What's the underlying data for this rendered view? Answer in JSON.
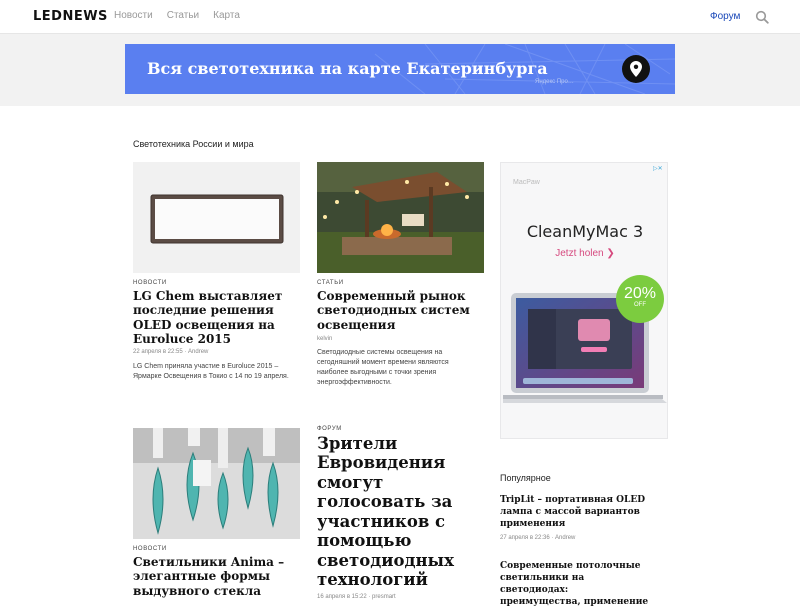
{
  "header": {
    "logo": "LEDNEWS",
    "nav": [
      "Новости",
      "Статьи",
      "Карта"
    ],
    "forum": "Форум",
    "search_icon": "search-icon"
  },
  "banner": {
    "text": "Вся светотехника на карте Екатеринбурга",
    "attribution": "Яндекс    Про…",
    "icon": "map-pin-icon",
    "color": "#5a7ff0"
  },
  "section": {
    "label": "Светотехника России и мира"
  },
  "cards": [
    {
      "category": "НОВОСТИ",
      "title": "LG Chem выставляет последние решения OLED освещения на Euroluce 2015",
      "meta": "22 апреля в 22:55 · Andrew",
      "excerpt": "LG Chem приняла участие в Euroluce 2015 – Ярмарке Освещения в Токио с 14 по 19 апреля."
    },
    {
      "category": "СТАТЬИ",
      "title": "Современный рынок светодиодных систем освещения",
      "meta": "kelvin",
      "excerpt": "Светодиодные системы освещения на сегодняшний момент времени являются наиболее выгодными с точки зрения энергоэффективности."
    },
    {
      "category": "НОВОСТИ",
      "title": "Светильники Anima – элегантные формы выдувного стекла"
    },
    {
      "category": "ФОРУМ",
      "title": "Зрители Евровидения смогут голосовать за участников с помощью светодиодных технологий",
      "meta": "16 апреля в 15:22 · presmart"
    }
  ],
  "ad": {
    "brand": "MacPaw",
    "title": "CleanMyMac 3",
    "cta": "Jetzt holen ❯",
    "discount": "20%",
    "discount_label": "OFF",
    "badge_color": "#7ccc3f"
  },
  "popular": {
    "heading": "Популярное",
    "items": [
      {
        "title": "TripLit – портативная OLED лампа с массой вариантов применения",
        "meta": "27 апреля в 22:36 · Andrew"
      },
      {
        "title": "Современные потолочные светильники на светодиодах: преимущества, применение"
      }
    ]
  }
}
